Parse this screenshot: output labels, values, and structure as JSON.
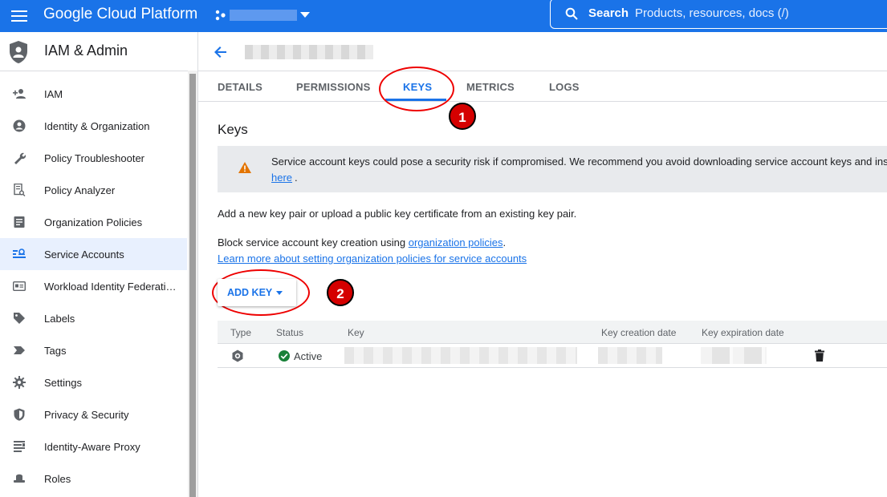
{
  "topbar": {
    "brand": "Google Cloud Platform",
    "search_label": "Search",
    "search_placeholder": "Products, resources, docs (/)",
    "accent": "#1a73e8"
  },
  "sidebar": {
    "title": "IAM & Admin",
    "items": [
      {
        "label": "IAM",
        "icon": "person-add-icon"
      },
      {
        "label": "Identity & Organization",
        "icon": "account-circle-icon"
      },
      {
        "label": "Policy Troubleshooter",
        "icon": "wrench-icon"
      },
      {
        "label": "Policy Analyzer",
        "icon": "document-search-icon"
      },
      {
        "label": "Organization Policies",
        "icon": "list-document-icon"
      },
      {
        "label": "Service Accounts",
        "icon": "service-account-icon",
        "active": true
      },
      {
        "label": "Workload Identity Federati…",
        "icon": "id-card-icon"
      },
      {
        "label": "Labels",
        "icon": "label-icon"
      },
      {
        "label": "Tags",
        "icon": "tag-icon"
      },
      {
        "label": "Settings",
        "icon": "gear-icon"
      },
      {
        "label": "Privacy & Security",
        "icon": "shield-icon"
      },
      {
        "label": "Identity-Aware Proxy",
        "icon": "proxy-icon"
      },
      {
        "label": "Roles",
        "icon": "hat-icon"
      }
    ]
  },
  "tabs": [
    {
      "label": "DETAILS"
    },
    {
      "label": "PERMISSIONS"
    },
    {
      "label": "KEYS",
      "selected": true
    },
    {
      "label": "METRICS"
    },
    {
      "label": "LOGS"
    }
  ],
  "annotations": {
    "badge1": "1",
    "badge2": "2"
  },
  "keys": {
    "title": "Keys",
    "warning_text": "Service account keys could pose a security risk if compromised. We recommend you avoid downloading service account keys and ins",
    "warning_link": "here",
    "warning_end": ".",
    "intro": "Add a new key pair or upload a public key certificate from an existing key pair.",
    "block_text": "Block service account key creation using ",
    "block_link": "organization policies",
    "block_end": ".",
    "learn_more": "Learn more about setting organization policies for service accounts",
    "add_key": "ADD KEY"
  },
  "table": {
    "headers": [
      "Type",
      "Status",
      "Key",
      "Key creation date",
      "Key expiration date"
    ],
    "rows": [
      {
        "status": "Active"
      }
    ]
  }
}
